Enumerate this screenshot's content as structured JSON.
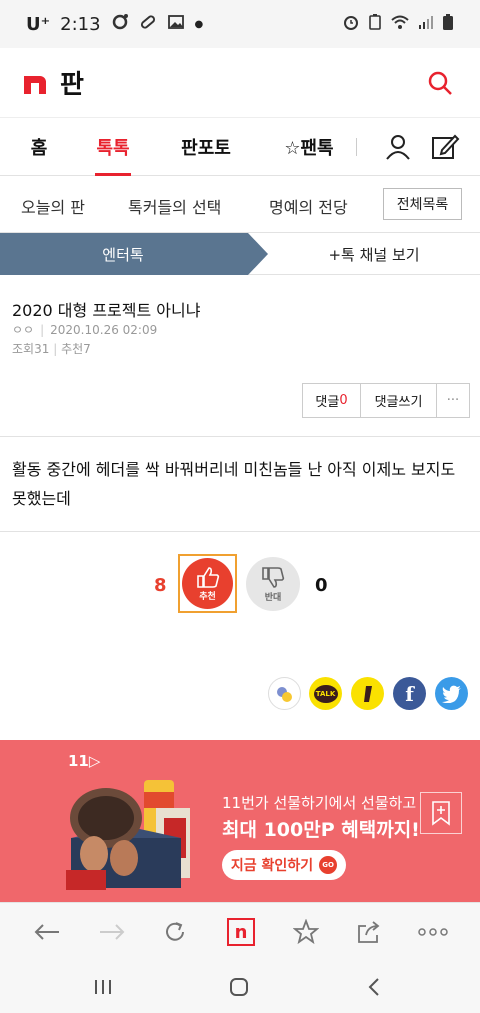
{
  "status": {
    "carrier": "U⁺",
    "time": "2:13",
    "icons": [
      "app-icon",
      "link-icon",
      "image-icon",
      "dot-icon",
      "alarm-icon",
      "battery-saver-icon",
      "wifi-icon",
      "signal-icon",
      "battery-icon"
    ]
  },
  "header": {
    "brand": "판",
    "logo": "n"
  },
  "nav": {
    "tabs": [
      "홈",
      "톡톡",
      "판포토",
      "☆팬톡"
    ],
    "active": "톡톡"
  },
  "subnav": {
    "items": [
      "오늘의 판",
      "톡커들의 선택",
      "명예의 전당"
    ],
    "all_button": "전체목록"
  },
  "channel": {
    "active": "엔터톡",
    "more": "+톡 채널 보기"
  },
  "post": {
    "title": "2020 대형 프로젝트 아니냐",
    "author": "ㅇㅇ",
    "date": "2020.10.26 02:09",
    "views_label": "조회31",
    "recommend_label": "추천7",
    "body": "활동 중간에 헤더를 싹 바꿔버리네 미친놈들 난 아직 이제노 보지도 못했는데"
  },
  "actions": {
    "comment_label": "댓글",
    "comment_count": "0",
    "write_comment": "댓글쓰기",
    "more": "···"
  },
  "vote": {
    "like_count": "8",
    "like_label": "추천",
    "dislike_label": "반대",
    "dislike_count": "0"
  },
  "share": [
    "kakao-story-icon",
    "kakaotalk-icon",
    "kakao-channel-icon",
    "facebook-icon",
    "twitter-icon"
  ],
  "share_labels": {
    "kakaotalk": "TALK",
    "facebook": "f"
  },
  "ad": {
    "brand": "11▷",
    "line1": "11번가 선물하기에서 선물하고",
    "line2": "최대 100만P 혜택까지!",
    "cta": "지금 확인하기",
    "cta_badge": "GO"
  },
  "browser": {
    "tab_logo": "n"
  },
  "colors": {
    "accent": "#e8222e",
    "channel_bg": "#5a7590",
    "ad_bg": "#f0676b",
    "like": "#e8402e"
  }
}
